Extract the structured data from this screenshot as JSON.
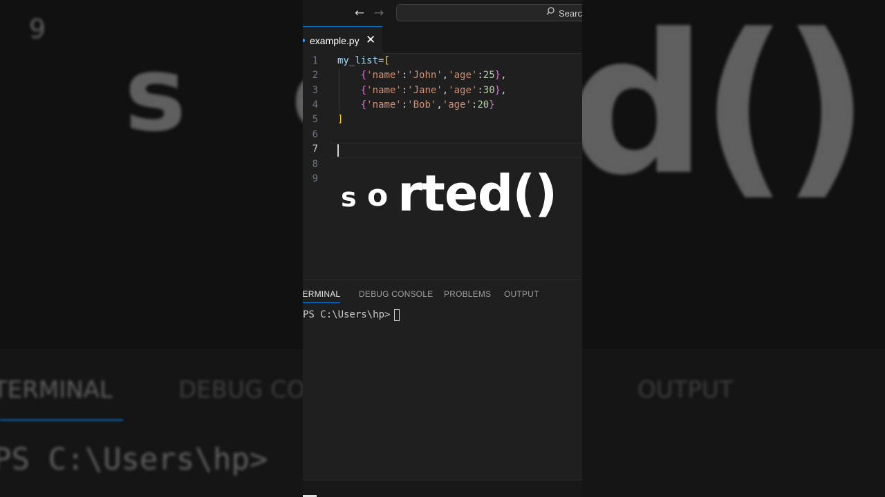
{
  "background": {
    "left_digit": "9",
    "left_big_letters": "s o",
    "right_big_letters": "d()",
    "left_panel_tab": "TERMINAL",
    "left_panel_tab2": "DEBUG CO",
    "right_panel_tab": "OUTPUT",
    "left_prompt": "PS C:\\Users\\hp>"
  },
  "titlebar": {
    "back_icon": "arrow-left-icon",
    "forward_icon": "arrow-right-icon",
    "search_label": "Search"
  },
  "tab": {
    "filename": "example.py",
    "close_symbol": "✕"
  },
  "editor": {
    "line_numbers": [
      "1",
      "2",
      "3",
      "4",
      "5",
      "6",
      "7",
      "8",
      "9"
    ],
    "active_line": "7",
    "code_lines": [
      "my_list=[",
      "    {'name':'John','age':25},",
      "    {'name':'Jane','age':30},",
      "    {'name':'Bob','age':20}",
      "]",
      "",
      "",
      "",
      ""
    ]
  },
  "overlay_caption": {
    "part1": "s",
    "part2": "o",
    "part3": "rted()"
  },
  "panel": {
    "tabs": [
      "TERMINAL",
      "DEBUG CONSOLE",
      "PROBLEMS",
      "OUTPUT"
    ],
    "active_tab": "TERMINAL",
    "terminal_prompt": "PS C:\\Users\\hp> "
  },
  "colors": {
    "accent": "#0078d4",
    "editor_bg": "#1f1f1f",
    "variable": "#9cdcfe",
    "string": "#ce9178",
    "number": "#b5cea8",
    "bracket_outer": "#ffd700",
    "bracket_inner": "#da70d6"
  }
}
